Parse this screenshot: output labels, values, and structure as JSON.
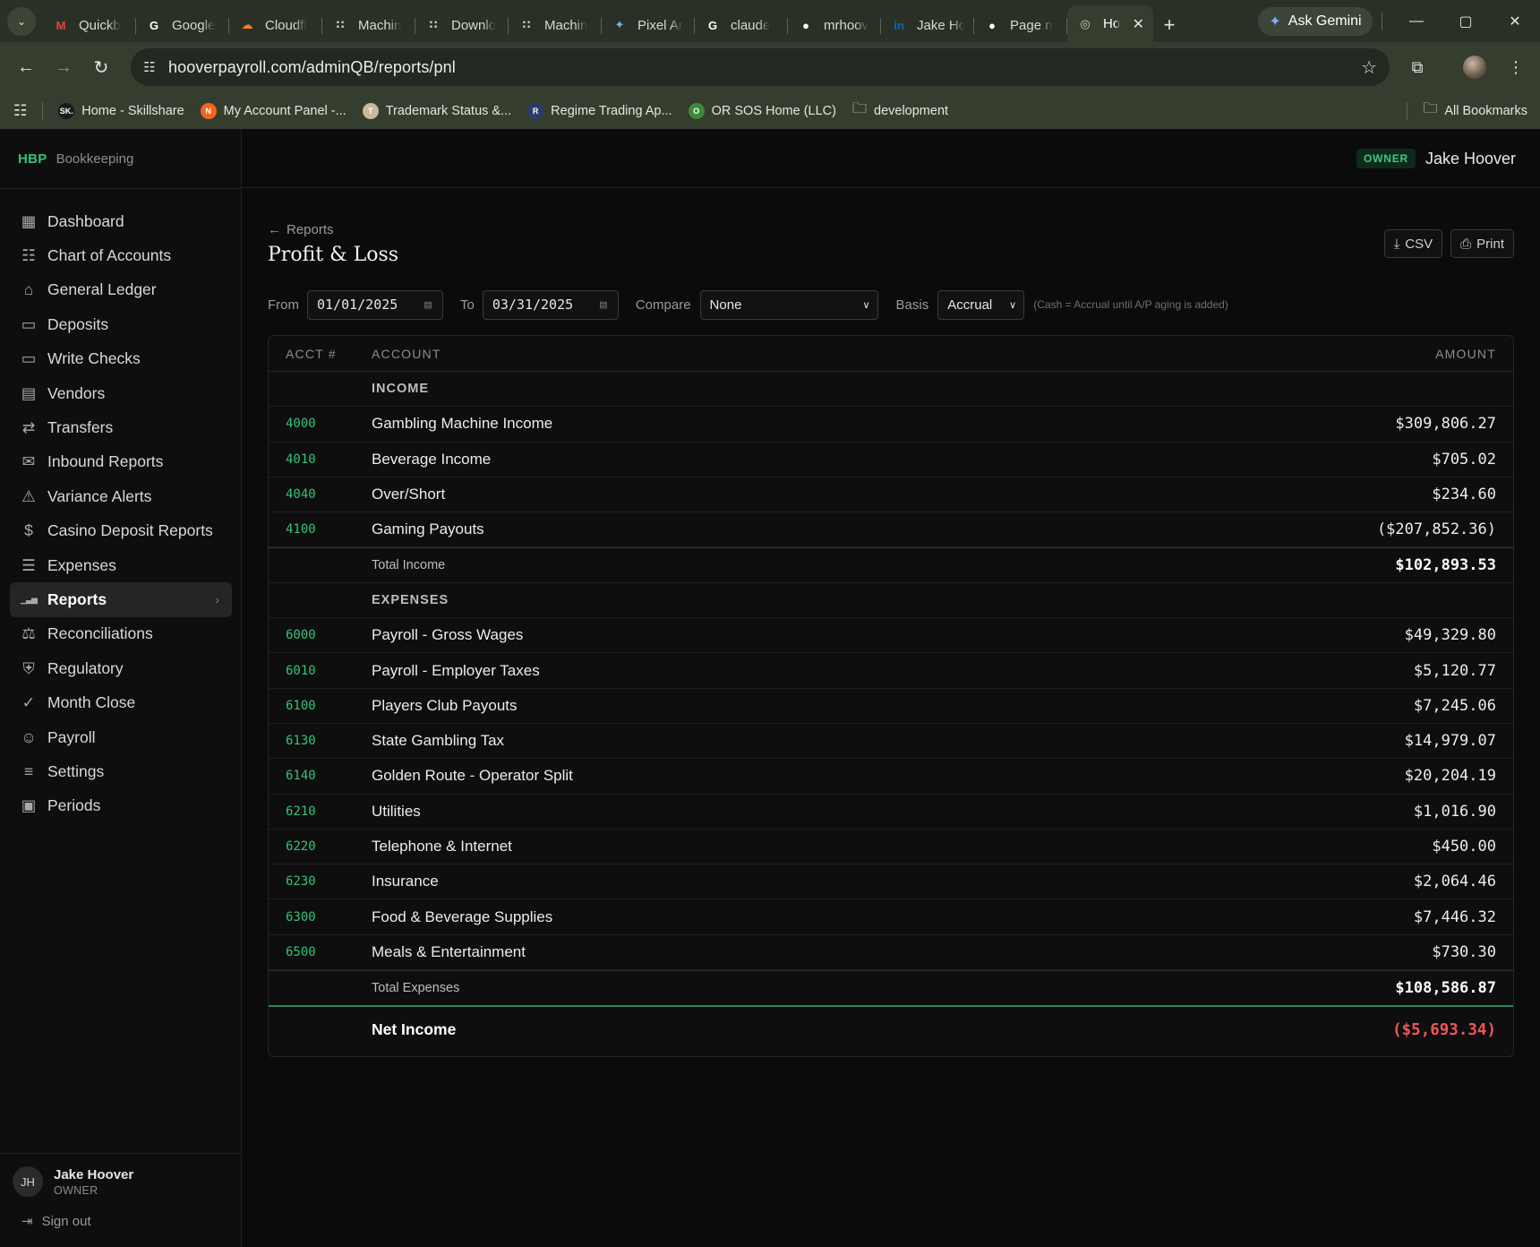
{
  "browser": {
    "tabs": [
      {
        "label": "Quickb",
        "icon": "gmail-icon"
      },
      {
        "label": "Google",
        "icon": "google-icon"
      },
      {
        "label": "Cloudfl",
        "icon": "cloudflare-icon"
      },
      {
        "label": "Machin",
        "icon": "dots-icon"
      },
      {
        "label": "Downlo",
        "icon": "dots-icon"
      },
      {
        "label": "Machin",
        "icon": "dots-icon"
      },
      {
        "label": "Pixel Ar",
        "icon": "gemini-icon"
      },
      {
        "label": "claude",
        "icon": "google-icon"
      },
      {
        "label": "mrhoov",
        "icon": "github-icon"
      },
      {
        "label": "Jake Ho",
        "icon": "linkedin-icon"
      },
      {
        "label": "Page n",
        "icon": "github-icon"
      }
    ],
    "active_tab": {
      "label": "Ho",
      "icon": "globe-icon"
    },
    "ask_gemini": "Ask Gemini",
    "url": "hooverpayroll.com/adminQB/reports/pnl",
    "bookmarks": [
      {
        "label": "Home - Skillshare",
        "icon_text": "SK."
      },
      {
        "label": "My Account Panel -...",
        "icon_text": "N"
      },
      {
        "label": "Trademark Status &...",
        "icon_text": "T"
      },
      {
        "label": "Regime Trading Ap...",
        "icon_text": "R"
      },
      {
        "label": "OR SOS Home (LLC)",
        "icon_text": "O"
      },
      {
        "label": "development",
        "icon_text": ""
      }
    ],
    "all_bookmarks": "All Bookmarks"
  },
  "app": {
    "brand_logo": "HBP",
    "brand_name": "Bookkeeping",
    "role_badge": "OWNER",
    "top_user": "Jake Hoover",
    "nav": [
      {
        "label": "Dashboard",
        "icon": "dashboard-icon"
      },
      {
        "label": "Chart of Accounts",
        "icon": "book-icon"
      },
      {
        "label": "General Ledger",
        "icon": "bank-icon"
      },
      {
        "label": "Deposits",
        "icon": "cash-icon"
      },
      {
        "label": "Write Checks",
        "icon": "card-icon"
      },
      {
        "label": "Vendors",
        "icon": "building-icon"
      },
      {
        "label": "Transfers",
        "icon": "transfer-icon"
      },
      {
        "label": "Inbound Reports",
        "icon": "mail-icon"
      },
      {
        "label": "Variance Alerts",
        "icon": "warning-icon"
      },
      {
        "label": "Casino Deposit Reports",
        "icon": "dollar-doc-icon"
      },
      {
        "label": "Expenses",
        "icon": "receipt-icon"
      },
      {
        "label": "Reports",
        "icon": "bar-chart-icon",
        "active": true
      },
      {
        "label": "Reconciliations",
        "icon": "scale-icon"
      },
      {
        "label": "Regulatory",
        "icon": "shield-icon"
      },
      {
        "label": "Month Close",
        "icon": "clipboard-check-icon"
      },
      {
        "label": "Payroll",
        "icon": "users-icon"
      },
      {
        "label": "Settings",
        "icon": "sliders-icon"
      },
      {
        "label": "Periods",
        "icon": "calendar-icon"
      }
    ],
    "user": {
      "initials": "JH",
      "name": "Jake Hoover",
      "role": "OWNER"
    },
    "sign_out": "Sign out"
  },
  "page": {
    "back_link": "Reports",
    "title": "Profit & Loss",
    "csv_label": "CSV",
    "print_label": "Print",
    "filters": {
      "from_label": "From",
      "from_value": "01/01/2025",
      "to_label": "To",
      "to_value": "03/31/2025",
      "compare_label": "Compare",
      "compare_value": "None",
      "basis_label": "Basis",
      "basis_value": "Accrual",
      "note": "(Cash = Accrual until A/P aging is added)"
    },
    "columns": {
      "acct": "ACCT #",
      "account": "ACCOUNT",
      "amount": "AMOUNT"
    },
    "income": {
      "heading": "INCOME",
      "rows": [
        {
          "acct": "4000",
          "name": "Gambling Machine Income",
          "amount": "$309,806.27"
        },
        {
          "acct": "4010",
          "name": "Beverage Income",
          "amount": "$705.02"
        },
        {
          "acct": "4040",
          "name": "Over/Short",
          "amount": "$234.60"
        },
        {
          "acct": "4100",
          "name": "Gaming Payouts",
          "amount": "($207,852.36)"
        }
      ],
      "total_label": "Total Income",
      "total_amount": "$102,893.53"
    },
    "expenses": {
      "heading": "EXPENSES",
      "rows": [
        {
          "acct": "6000",
          "name": "Payroll - Gross Wages",
          "amount": "$49,329.80"
        },
        {
          "acct": "6010",
          "name": "Payroll - Employer Taxes",
          "amount": "$5,120.77"
        },
        {
          "acct": "6100",
          "name": "Players Club Payouts",
          "amount": "$7,245.06"
        },
        {
          "acct": "6130",
          "name": "State Gambling Tax",
          "amount": "$14,979.07"
        },
        {
          "acct": "6140",
          "name": "Golden Route - Operator Split",
          "amount": "$20,204.19"
        },
        {
          "acct": "6210",
          "name": "Utilities",
          "amount": "$1,016.90"
        },
        {
          "acct": "6220",
          "name": "Telephone & Internet",
          "amount": "$450.00"
        },
        {
          "acct": "6230",
          "name": "Insurance",
          "amount": "$2,064.46"
        },
        {
          "acct": "6300",
          "name": "Food & Beverage Supplies",
          "amount": "$7,446.32"
        },
        {
          "acct": "6500",
          "name": "Meals & Entertainment",
          "amount": "$730.30"
        }
      ],
      "total_label": "Total Expenses",
      "total_amount": "$108,586.87"
    },
    "net_income": {
      "label": "Net Income",
      "amount": "($5,693.34)"
    }
  },
  "colors": {
    "accent": "#37c17a",
    "negative": "#f0555a",
    "background": "#0b0b0b"
  }
}
